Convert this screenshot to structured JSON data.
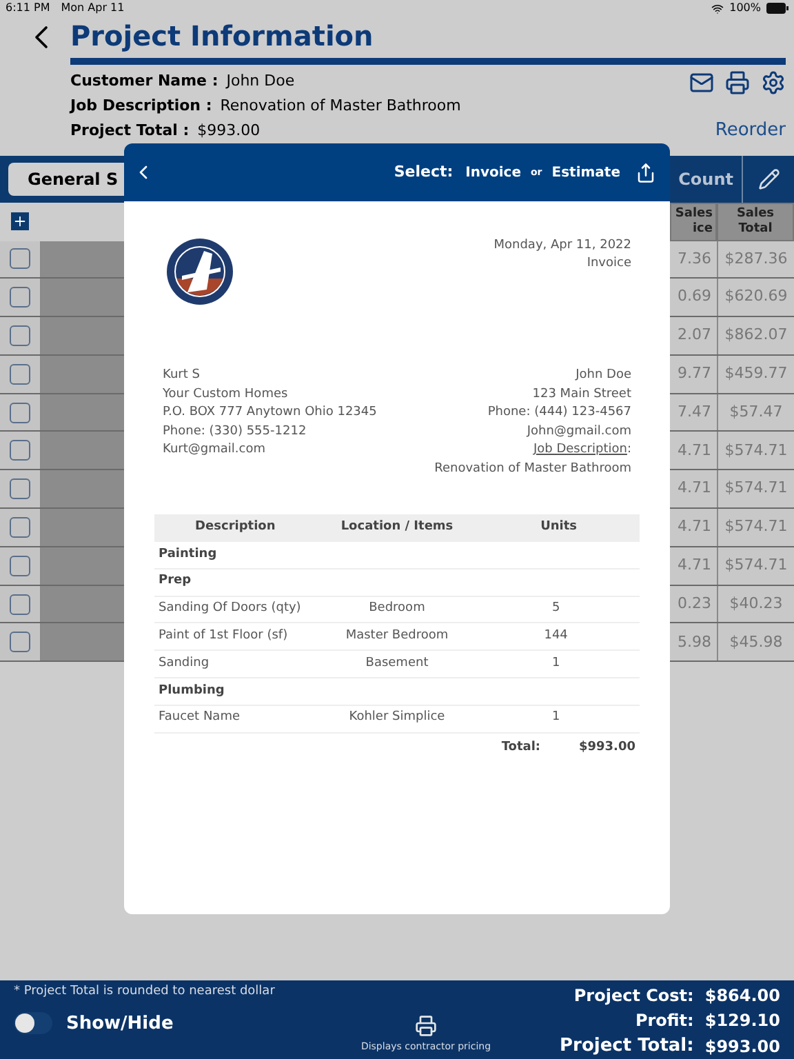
{
  "status_bar": {
    "time": "6:11 PM",
    "date": "Mon Apr 11",
    "battery": "100%"
  },
  "header": {
    "title": "Project Information"
  },
  "info": [
    {
      "label": "Customer Name :",
      "value": "John Doe"
    },
    {
      "label": "Job Description :",
      "value": "Renovation of Master Bathroom"
    },
    {
      "label": "Project Total :",
      "value": "$993.00"
    }
  ],
  "reorder": "Reorder",
  "tabs": [
    {
      "label": "General S",
      "selected": true
    },
    {
      "label": "Count",
      "selected": false
    }
  ],
  "table": {
    "columns": [
      [
        "Sales",
        "ice"
      ],
      [
        "Sales",
        "Total"
      ]
    ],
    "rows": [
      {
        "checked": false,
        "price": "7.36",
        "total": "$287.36"
      },
      {
        "checked": false,
        "price": "0.69",
        "total": "$620.69"
      },
      {
        "checked": false,
        "price": "2.07",
        "total": "$862.07"
      },
      {
        "checked": false,
        "price": "9.77",
        "total": "$459.77"
      },
      {
        "checked": false,
        "price": "7.47",
        "total": "$57.47"
      },
      {
        "checked": false,
        "price": "4.71",
        "total": "$574.71"
      },
      {
        "checked": false,
        "price": "4.71",
        "total": "$574.71"
      },
      {
        "checked": false,
        "price": "4.71",
        "total": "$574.71"
      },
      {
        "checked": false,
        "price": "4.71",
        "total": "$574.71"
      },
      {
        "checked": false,
        "price": "0.23",
        "total": "$40.23"
      },
      {
        "checked": false,
        "price": "5.98",
        "total": "$45.98"
      }
    ]
  },
  "modal": {
    "select_label": "Select:",
    "options": [
      "Invoice",
      "Estimate"
    ],
    "separator": "or",
    "invoice": {
      "date": "Monday, Apr 11, 2022",
      "type": "Invoice",
      "from": [
        "Kurt S",
        "Your Custom Homes",
        "P.O. BOX 777 Anytown Ohio 12345",
        "Phone: (330) 555-1212",
        "Kurt@gmail.com"
      ],
      "to": [
        {
          "kind": "plain",
          "text": "John Doe"
        },
        {
          "kind": "plain",
          "text": "123 Main Street"
        },
        {
          "kind": "plain",
          "text": "Phone: (444) 123-4567"
        },
        {
          "kind": "plain",
          "text": "John@gmail.com"
        },
        {
          "kind": "heading",
          "text": "Job Description",
          "suffix": ":"
        },
        {
          "kind": "plain",
          "text": "Renovation of Master Bathroom"
        }
      ],
      "columns": [
        "Description",
        "Location / Items",
        "Units"
      ],
      "rows": [
        {
          "kind": "group",
          "description": "Painting"
        },
        {
          "kind": "group",
          "description": "Prep"
        },
        {
          "kind": "item",
          "description": "Sanding Of Doors (qty)",
          "location": "Bedroom",
          "units": "5"
        },
        {
          "kind": "item",
          "description": "Paint of 1st Floor (sf)",
          "location": "Master Bedroom",
          "units": "144"
        },
        {
          "kind": "item",
          "description": "Sanding",
          "location": "Basement",
          "units": "1"
        },
        {
          "kind": "group",
          "description": "Plumbing"
        },
        {
          "kind": "item",
          "description": "Faucet Name",
          "location": "Kohler Simplice",
          "units": "1"
        }
      ],
      "total_label": "Total:",
      "total_value": "$993.00"
    }
  },
  "footer": {
    "note": "* Project Total is rounded to nearest dollar",
    "toggle": {
      "label": "Show/Hide",
      "on": false
    },
    "print_caption": "Displays contractor pricing",
    "totals": [
      {
        "label": "Project Cost:",
        "value": "$864.00"
      },
      {
        "label": "Profit:",
        "value": "$129.10"
      },
      {
        "label": "Project Total:",
        "value": "$993.00"
      }
    ]
  }
}
